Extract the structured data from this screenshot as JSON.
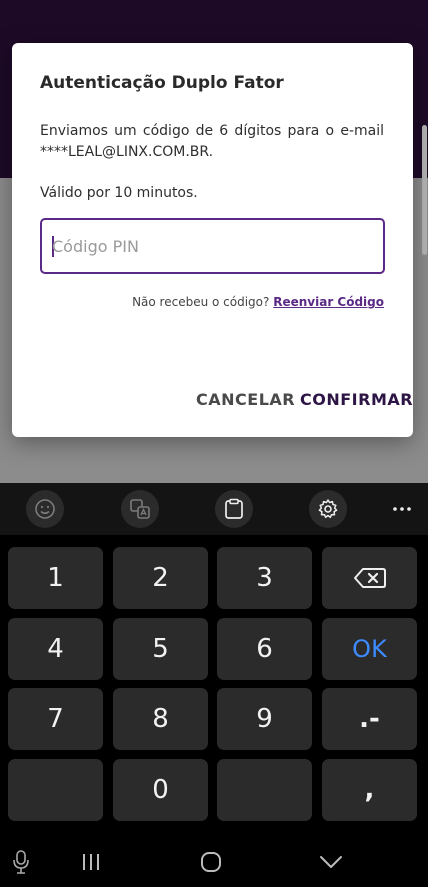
{
  "dialog": {
    "title": "Autenticação Duplo Fator",
    "message": "Enviamos um código de 6 dígitos para o e-mail ****LEAL@LINX.COM.BR.",
    "validity": "Válido por 10 minutos.",
    "pin_placeholder": "Código PIN",
    "pin_value": "",
    "resend_prompt": "Não recebeu o código?",
    "resend_link": "Reenviar Código",
    "cancel_label": "CANCELAR",
    "confirm_label": "CONFIRMAR",
    "accent_color": "#5b2a86"
  },
  "keyboard": {
    "toolbar": [
      "emoji-icon",
      "translate-icon",
      "clipboard-icon",
      "gear-icon",
      "more-icon"
    ],
    "keys": [
      "1",
      "2",
      "3",
      "⌫",
      "4",
      "5",
      "6",
      "OK",
      "7",
      "8",
      "9",
      ".-",
      "",
      "0",
      "",
      ","
    ],
    "ok_color": "#3d8bff"
  },
  "navbar": {
    "items": [
      "mic-icon",
      "recents-icon",
      "home-icon",
      "back-icon"
    ]
  }
}
